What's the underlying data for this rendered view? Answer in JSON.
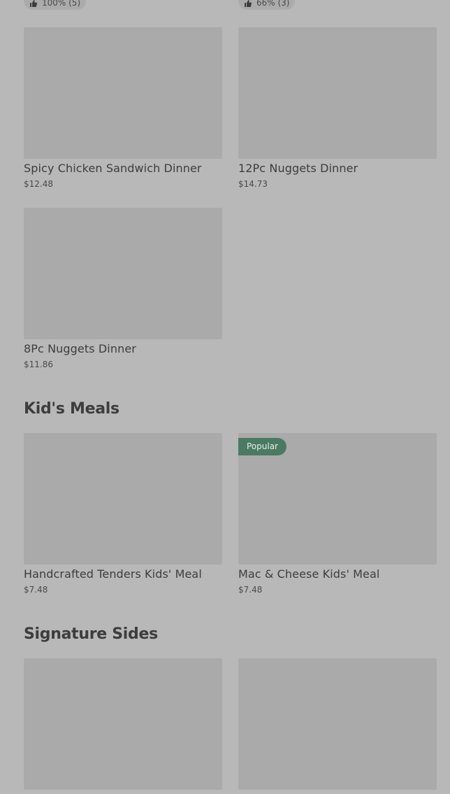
{
  "ratings": [
    {
      "label": "100% (5)"
    },
    {
      "label": "66% (3)"
    }
  ],
  "dinners": [
    {
      "title": "Spicy Chicken Sandwich Dinner",
      "price": "$12.48"
    },
    {
      "title": "12Pc Nuggets Dinner",
      "price": "$14.73"
    },
    {
      "title": "8Pc Nuggets Dinner",
      "price": "$11.86"
    }
  ],
  "kids_meals": {
    "heading": "Kid's Meals",
    "items": [
      {
        "title": "Handcrafted Tenders Kids' Meal",
        "price": "$7.48"
      },
      {
        "title": "Mac & Cheese Kids' Meal",
        "price": "$7.48",
        "badge": "Popular"
      }
    ]
  },
  "signature_sides": {
    "heading": "Signature Sides"
  },
  "colors": {
    "background": "#b8b8b8",
    "image_placeholder": "#aaaaaa",
    "badge": "#4a7a62"
  }
}
